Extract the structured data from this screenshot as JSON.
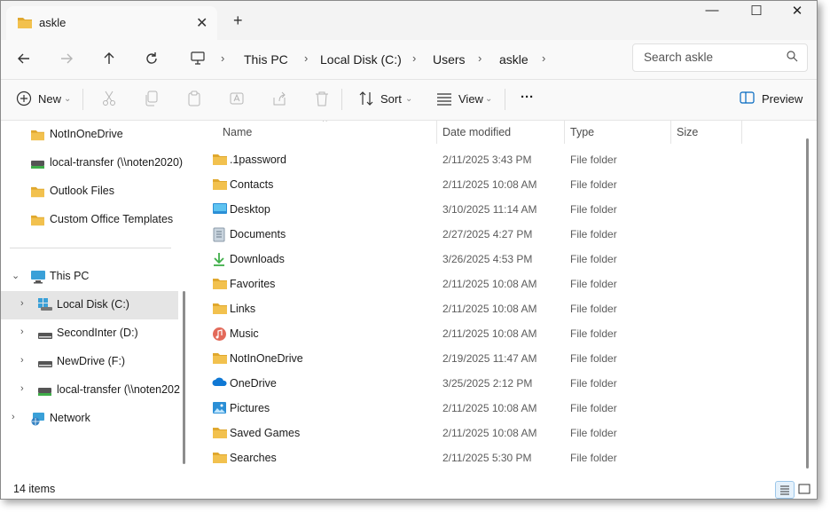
{
  "window": {
    "tab_title": "askle",
    "minimize": "—",
    "maximize": "☐",
    "close": "✕",
    "tab_close": "✕",
    "new_tab": "+"
  },
  "navbar": {
    "breadcrumbs": [
      "This PC",
      "Local Disk (C:)",
      "Users",
      "askle"
    ],
    "search_placeholder": "Search askle"
  },
  "commandbar": {
    "new_label": "New",
    "sort_label": "Sort",
    "view_label": "View",
    "more_label": "···",
    "preview_label": "Preview"
  },
  "navpane": {
    "quick": [
      {
        "label": "NotInOneDrive",
        "icon": "folder-icon"
      },
      {
        "label": "local-transfer (\\\\noten2020)",
        "icon": "network-drive-icon"
      },
      {
        "label": "Outlook Files",
        "icon": "folder-icon"
      },
      {
        "label": "Custom Office Templates",
        "icon": "folder-icon"
      }
    ],
    "this_pc": "This PC",
    "drives": [
      {
        "label": "Local Disk (C:)",
        "icon": "windows-drive-icon"
      },
      {
        "label": "SecondInter (D:)",
        "icon": "drive-icon"
      },
      {
        "label": "NewDrive (F:)",
        "icon": "drive-icon"
      },
      {
        "label": "local-transfer (\\\\noten202",
        "icon": "network-drive-icon"
      }
    ],
    "network": "Network"
  },
  "content": {
    "columns": [
      "Name",
      "Date modified",
      "Type",
      "Size"
    ],
    "rows": [
      {
        "name": ".1password",
        "date": "2/11/2025 3:43 PM",
        "type": "File folder",
        "icon": "folder-icon"
      },
      {
        "name": "Contacts",
        "date": "2/11/2025 10:08 AM",
        "type": "File folder",
        "icon": "folder-icon"
      },
      {
        "name": "Desktop",
        "date": "3/10/2025 11:14 AM",
        "type": "File folder",
        "icon": "desktop-icon"
      },
      {
        "name": "Documents",
        "date": "2/27/2025 4:27 PM",
        "type": "File folder",
        "icon": "documents-icon"
      },
      {
        "name": "Downloads",
        "date": "3/26/2025 4:53 PM",
        "type": "File folder",
        "icon": "download-icon"
      },
      {
        "name": "Favorites",
        "date": "2/11/2025 10:08 AM",
        "type": "File folder",
        "icon": "folder-icon"
      },
      {
        "name": "Links",
        "date": "2/11/2025 10:08 AM",
        "type": "File folder",
        "icon": "folder-icon"
      },
      {
        "name": "Music",
        "date": "2/11/2025 10:08 AM",
        "type": "File folder",
        "icon": "music-icon"
      },
      {
        "name": "NotInOneDrive",
        "date": "2/19/2025 11:47 AM",
        "type": "File folder",
        "icon": "folder-icon"
      },
      {
        "name": "OneDrive",
        "date": "3/25/2025 2:12 PM",
        "type": "File folder",
        "icon": "onedrive-icon"
      },
      {
        "name": "Pictures",
        "date": "2/11/2025 10:08 AM",
        "type": "File folder",
        "icon": "pictures-icon"
      },
      {
        "name": "Saved Games",
        "date": "2/11/2025 10:08 AM",
        "type": "File folder",
        "icon": "folder-icon"
      },
      {
        "name": "Searches",
        "date": "2/11/2025 5:30 PM",
        "type": "File folder",
        "icon": "folder-icon"
      }
    ]
  },
  "status": {
    "item_count": "14 items"
  },
  "colors": {
    "folder": "#f2c14e",
    "folder_dark": "#e0a82e",
    "accent": "#0067c0",
    "selection": "#e5e5e5"
  }
}
